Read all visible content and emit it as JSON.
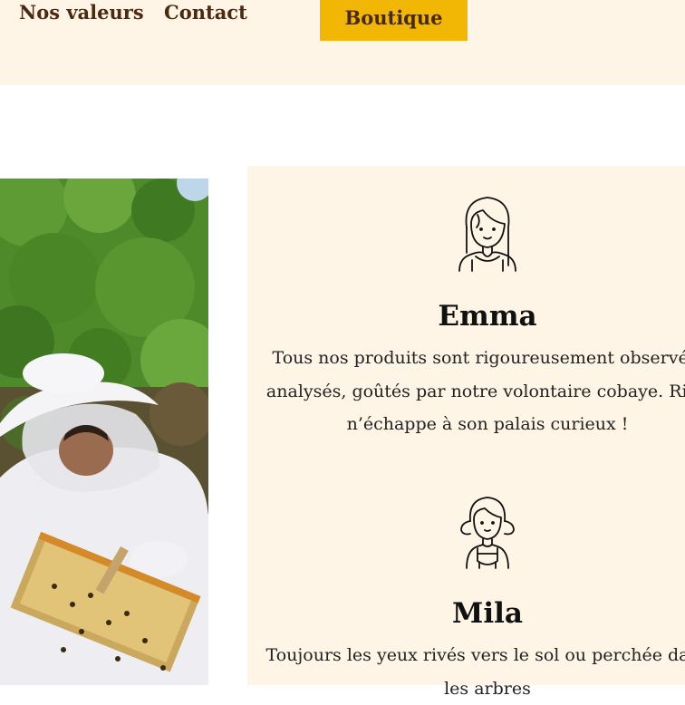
{
  "nav": {
    "values_label": "Nos valeurs",
    "contact_label": "Contact",
    "shop_label": "Boutique"
  },
  "team": [
    {
      "name": "Emma",
      "description": "Tous nos produits sont rigoureusement observés, analysés, goûtés par notre volontaire cobaye. Rien n’échappe à son palais curieux !"
    },
    {
      "name": "Mila",
      "description": "Toujours les yeux rivés vers le sol ou perchée dans les arbres"
    }
  ],
  "colors": {
    "header_bg": "#fef5e7",
    "accent": "#f2b705",
    "nav_text": "#4a2a12"
  }
}
